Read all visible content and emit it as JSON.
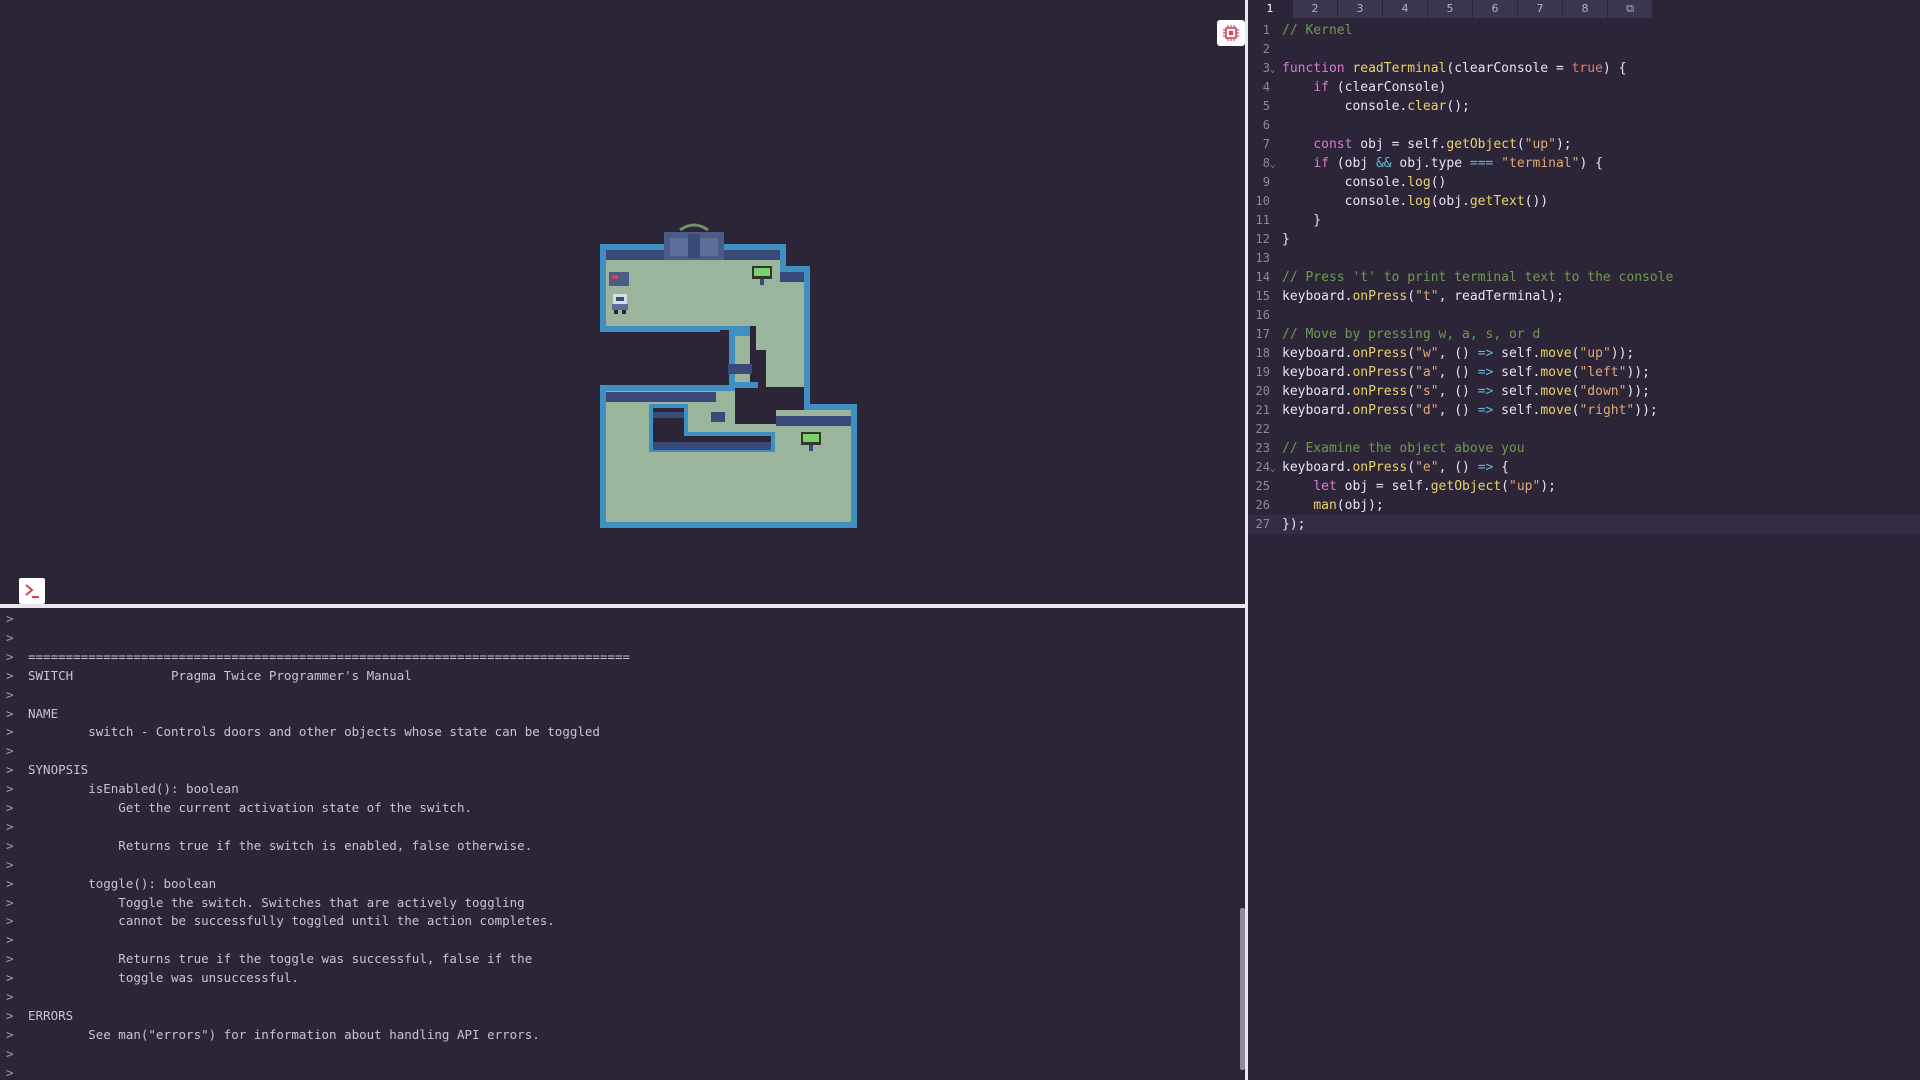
{
  "editor": {
    "tabs": [
      "1",
      "2",
      "3",
      "4",
      "5",
      "6",
      "7",
      "8",
      "⧉"
    ],
    "active_tab": "1",
    "lines": [
      "// Kernel",
      "",
      "function readTerminal(clearConsole = true) {",
      "    if (clearConsole)",
      "        console.clear();",
      "",
      "    const obj = self.getObject(\"up\");",
      "    if (obj && obj.type === \"terminal\") {",
      "        console.log()",
      "        console.log(obj.getText())",
      "    }",
      "}",
      "",
      "// Press 't' to print terminal text to the console",
      "keyboard.onPress(\"t\", readTerminal);",
      "",
      "// Move by pressing w, a, s, or d",
      "keyboard.onPress(\"w\", () => self.move(\"up\"));",
      "keyboard.onPress(\"a\", () => self.move(\"left\"));",
      "keyboard.onPress(\"s\", () => self.move(\"down\"));",
      "keyboard.onPress(\"d\", () => self.move(\"right\"));",
      "",
      "// Examine the object above you",
      "keyboard.onPress(\"e\", () => {",
      "    let obj = self.getObject(\"up\");",
      "    man(obj);",
      "});"
    ],
    "fold_lines": [
      3,
      8,
      24
    ],
    "current_line": 27
  },
  "console": {
    "prompt": ">",
    "lines": [
      "",
      "",
      "================================================================================",
      "SWITCH             Pragma Twice Programmer's Manual",
      "",
      "NAME",
      "        switch - Controls doors and other objects whose state can be toggled",
      "",
      "SYNOPSIS",
      "        isEnabled(): boolean",
      "            Get the current activation state of the switch.",
      "",
      "            Returns true if the switch is enabled, false otherwise.",
      "",
      "        toggle(): boolean",
      "            Toggle the switch. Switches that are actively toggling",
      "            cannot be successfully toggled until the action completes.",
      "",
      "            Returns true if the toggle was successful, false if the",
      "            toggle was unsuccessful.",
      "",
      "ERRORS",
      "        See man(\"errors\") for information about handling API errors.",
      "",
      ""
    ]
  },
  "icons": {
    "chip": "chip-icon",
    "terminal": "terminal-icon"
  },
  "colors": {
    "background": "#2b2537",
    "floor": "#9ab59b",
    "wall": "#3a4a78",
    "wall_border": "#3f8fc0",
    "accent_icon": "#d8405a"
  }
}
